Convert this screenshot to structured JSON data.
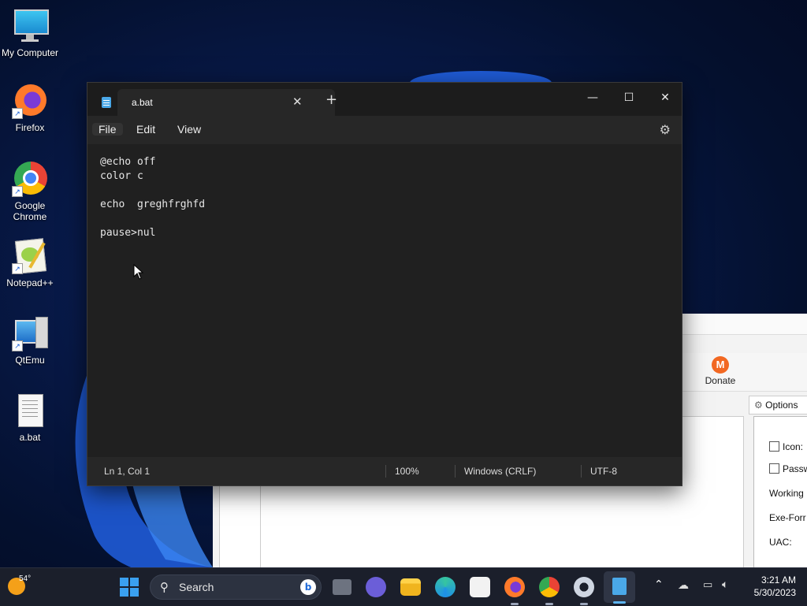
{
  "desktop": {
    "icons": [
      {
        "label": "My Computer"
      },
      {
        "label": "Firefox"
      },
      {
        "label": "Google Chrome"
      },
      {
        "label": "Notepad++"
      },
      {
        "label": "QtEmu"
      },
      {
        "label": "a.bat"
      }
    ]
  },
  "background_app": {
    "donate_label": "Donate",
    "options_tab": "Options",
    "options": [
      {
        "label": "Icon:",
        "type": "checkbox",
        "checked": false
      },
      {
        "label": "Passw",
        "type": "checkbox",
        "checked": false
      },
      {
        "label": "Working",
        "type": "text"
      },
      {
        "label": "Exe-Forr",
        "type": "text"
      },
      {
        "label": "UAC:",
        "type": "text"
      }
    ]
  },
  "notepad": {
    "tab_title": "a.bat",
    "menu": [
      "File",
      "Edit",
      "View"
    ],
    "content": "@echo off\ncolor c\n\necho  greghfrghfd\n\npause>nul",
    "status": {
      "position": "Ln 1, Col 1",
      "zoom": "100%",
      "line_ending": "Windows (CRLF)",
      "encoding": "UTF-8"
    }
  },
  "taskbar": {
    "weather_temp": "54°",
    "search_label": "Search",
    "time": "3:21 AM",
    "date": "5/30/2023"
  },
  "colors": {
    "accent": "#4aa8e8",
    "notepad_bg": "#202020",
    "taskbar_bg": "#1b1f2b"
  }
}
